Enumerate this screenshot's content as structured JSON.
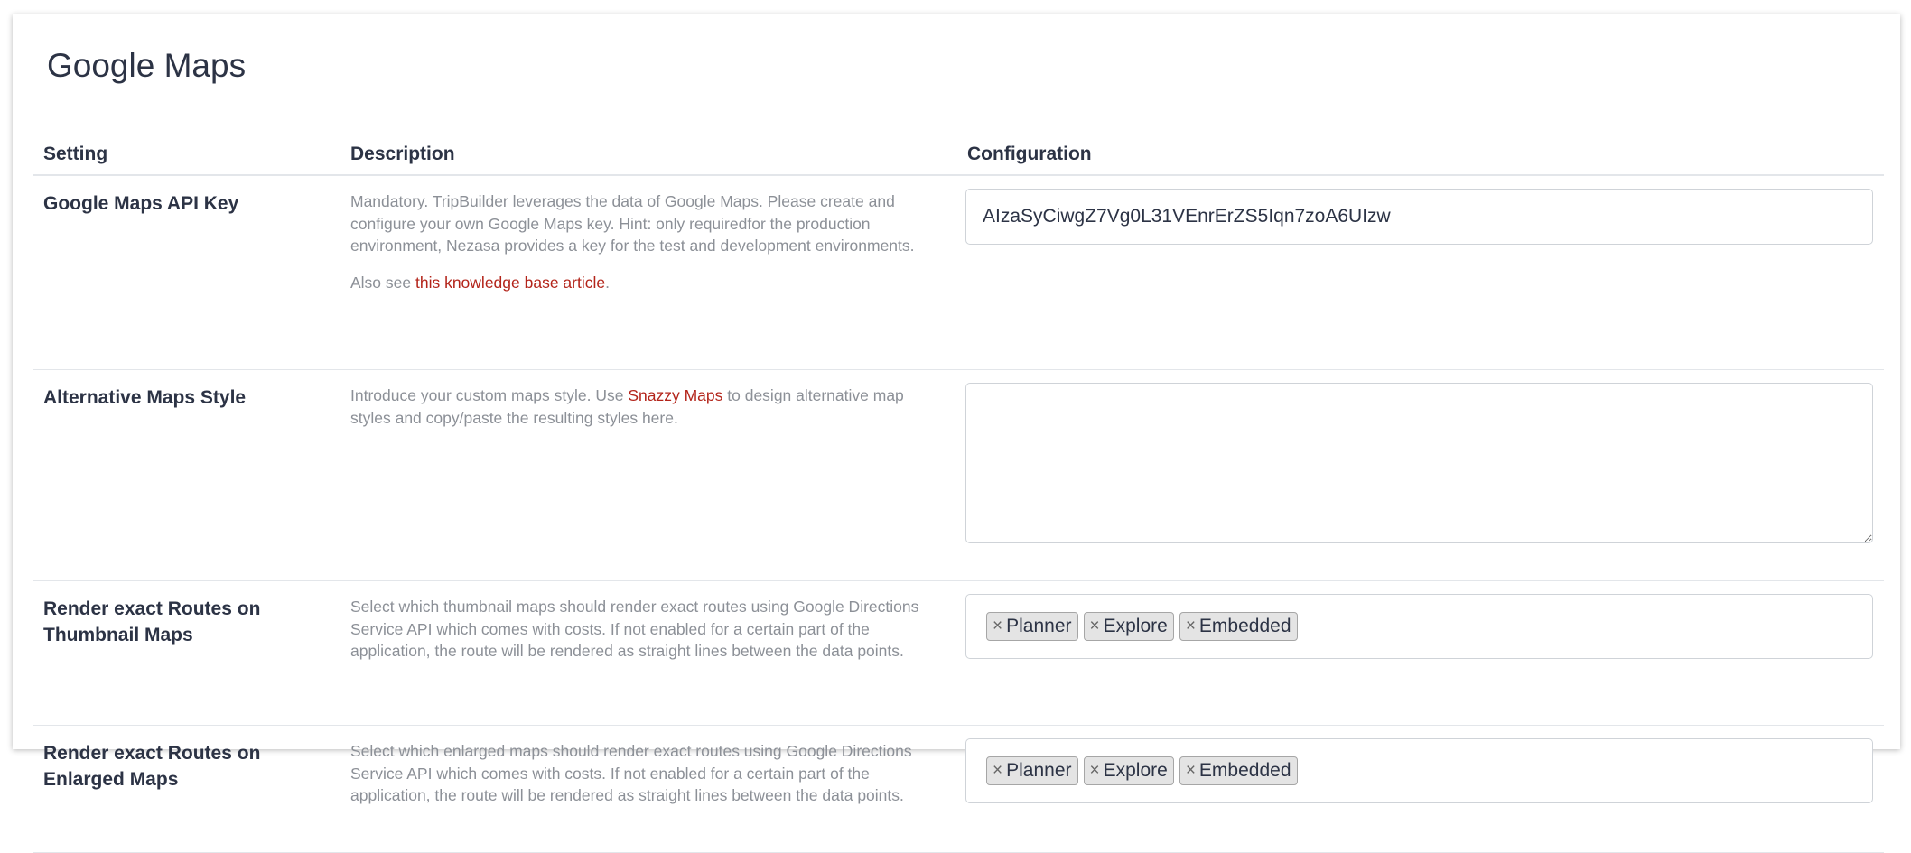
{
  "page": {
    "title": "Google Maps"
  },
  "table": {
    "headers": {
      "setting": "Setting",
      "description": "Description",
      "configuration": "Configuration"
    }
  },
  "rows": {
    "api_key": {
      "name": "Google Maps API Key",
      "description": "Mandatory. TripBuilder leverages the data of Google Maps. Please create and configure your own Google Maps key. Hint: only requiredfor the production environment, Nezasa provides a key for the test and development environments.",
      "also_see_prefix": "Also see ",
      "link_text": "this knowledge base article",
      "also_see_suffix": ".",
      "value": "AIzaSyCiwgZ7Vg0L31VEnrErZS5Iqn7zoA6UIzw"
    },
    "maps_style": {
      "name": "Alternative Maps Style",
      "description_prefix": "Introduce your custom maps style. Use ",
      "link_text": "Snazzy Maps",
      "description_suffix": " to design alternative map styles and copy/paste the resulting styles here.",
      "value": ""
    },
    "thumbnail_routes": {
      "name": "Render exact Routes on Thumbnail Maps",
      "description": "Select which thumbnail maps should render exact routes using Google Directions Service API which comes with costs. If not enabled for a certain part of the application, the route will be rendered as straight lines between the data points.",
      "tags": [
        "Planner",
        "Explore",
        "Embedded"
      ],
      "remove_symbol": "×"
    },
    "enlarged_routes": {
      "name": "Render exact Routes on Enlarged Maps",
      "description": "Select which enlarged maps should render exact routes using Google Directions Service API which comes with costs. If not enabled for a certain part of the application, the route will be rendered as straight lines between the data points.",
      "tags": [
        "Planner",
        "Explore",
        "Embedded"
      ],
      "remove_symbol": "×"
    }
  },
  "colors": {
    "link": "#b3241a",
    "text": "#2c3345",
    "muted": "#8c9097",
    "border": "#cfd3d8"
  }
}
